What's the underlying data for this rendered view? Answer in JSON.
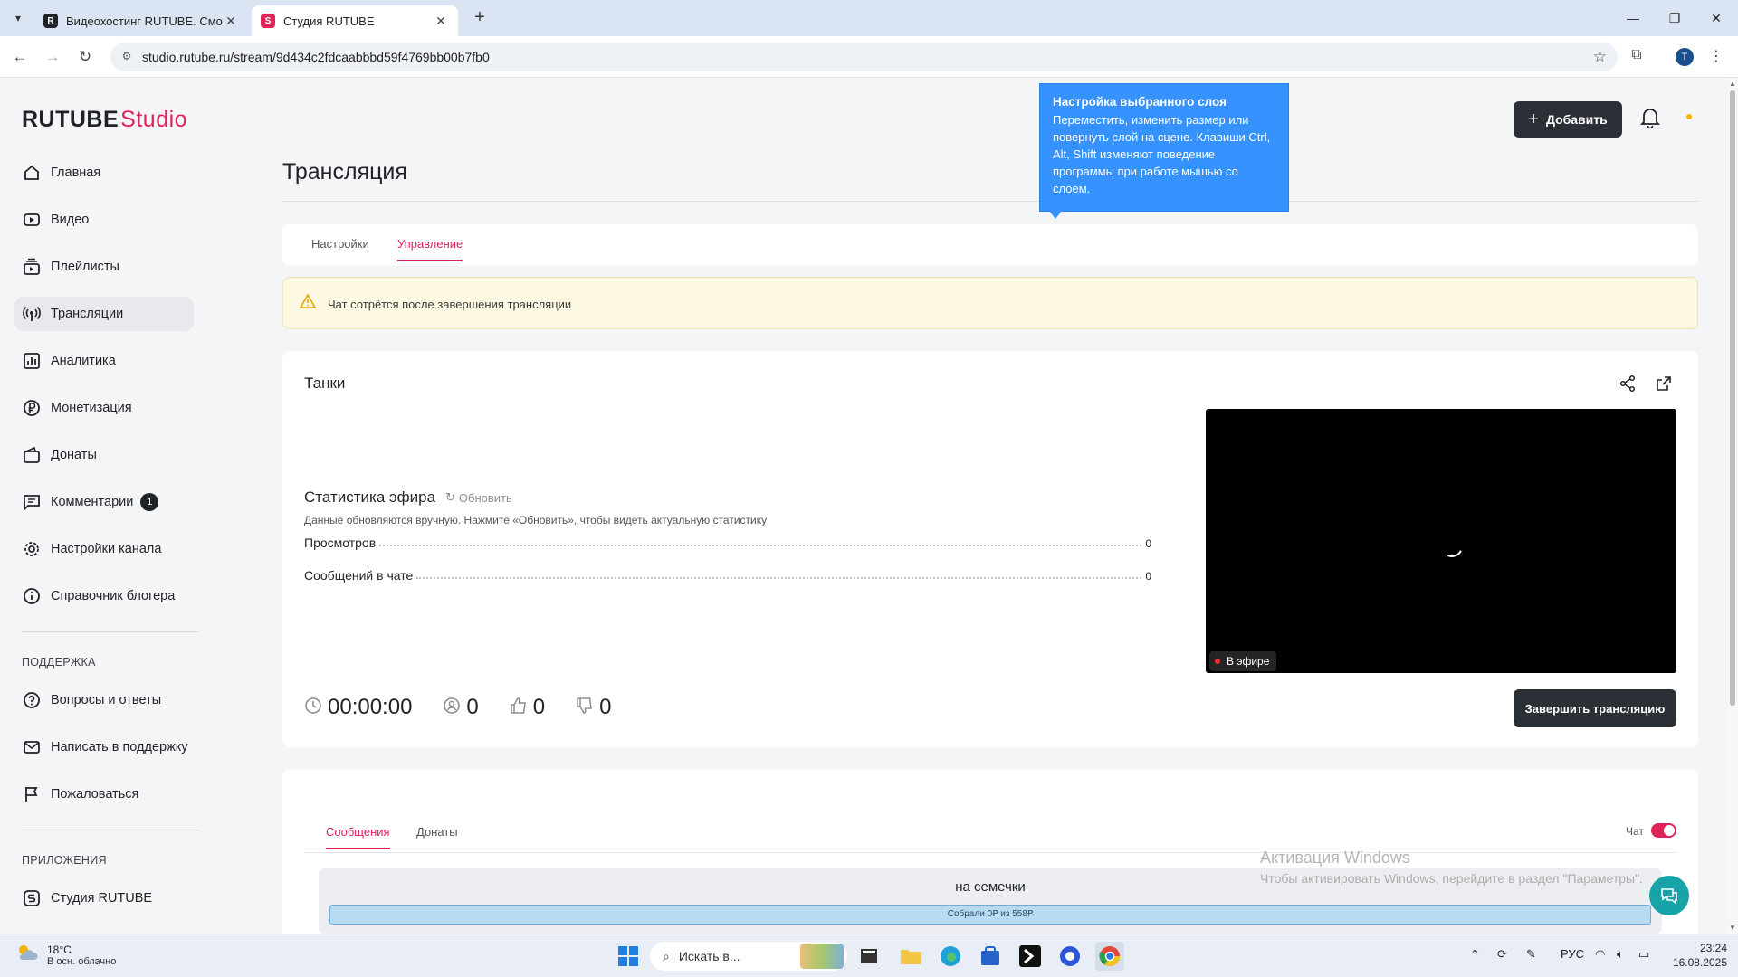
{
  "browser": {
    "tabs": [
      {
        "title": "Видеохостинг RUTUBE. Смотр...",
        "active": false
      },
      {
        "title": "Студия RUTUBE",
        "active": true
      }
    ],
    "url": "studio.rutube.ru/stream/9d434c2fdcaabbbd59f4769bb00b7fb0",
    "profile_initial": "T"
  },
  "header": {
    "logo_main": "RUTUBE",
    "logo_sub": "Studio",
    "add_button": "Добавить"
  },
  "sidebar": {
    "items": [
      {
        "label": "Главная",
        "icon": "home-icon"
      },
      {
        "label": "Видео",
        "icon": "video-icon"
      },
      {
        "label": "Плейлисты",
        "icon": "playlist-icon"
      },
      {
        "label": "Трансляции",
        "icon": "broadcast-icon",
        "active": true
      },
      {
        "label": "Аналитика",
        "icon": "analytics-icon"
      },
      {
        "label": "Монетизация",
        "icon": "ruble-icon"
      },
      {
        "label": "Донаты",
        "icon": "wallet-icon"
      },
      {
        "label": "Комментарии",
        "icon": "comment-icon",
        "badge": "1"
      },
      {
        "label": "Настройки канала",
        "icon": "gear-icon"
      },
      {
        "label": "Справочник блогера",
        "icon": "info-icon"
      }
    ],
    "support_title": "ПОДДЕРЖКА",
    "support_items": [
      {
        "label": "Вопросы и ответы",
        "icon": "question-icon"
      },
      {
        "label": "Написать в поддержку",
        "icon": "mail-icon"
      },
      {
        "label": "Пожаловаться",
        "icon": "flag-icon"
      }
    ],
    "apps_title": "ПРИЛОЖЕНИЯ",
    "apps_items": [
      {
        "label": "Студия RUTUBE",
        "icon": "studio-icon"
      }
    ]
  },
  "main": {
    "title": "Трансляция",
    "tabs": {
      "settings": "Настройки",
      "manage": "Управление"
    },
    "warning": "Чат сотрётся после завершения трансляции",
    "stream": {
      "name": "Танки",
      "stats_title": "Статистика эфира",
      "refresh_label": "Обновить",
      "stats_note": "Данные обновляются вручную. Нажмите «Обновить», чтобы видеть актуальную статистику",
      "views_label": "Просмотров",
      "views_value": "0",
      "messages_label": "Сообщений в чате",
      "messages_value": "0",
      "live_label": "В эфире",
      "timer": "00:00:00",
      "viewers": "0",
      "likes": "0",
      "dislikes": "0",
      "end_button": "Завершить трансляцию"
    },
    "chat": {
      "tab_messages": "Сообщения",
      "tab_donates": "Донаты",
      "chat_toggle_label": "Чат",
      "chat_enabled": true,
      "goal_title": "на семечки",
      "goal_progress": "Собрали 0₽  из 558₽",
      "goal_fraction": 0
    }
  },
  "tooltip": {
    "title": "Настройка выбранного слоя",
    "body": "Переместить, изменить размер или повернуть слой на сцене. Клавиши Ctrl, Alt, Shift изменяют поведение программы при работе мышью со слоем."
  },
  "watermark": {
    "line1": "Активация Windows",
    "line2": "Чтобы активировать Windows, перейдите в раздел \"Параметры\"."
  },
  "taskbar": {
    "temperature": "18°C",
    "weather": "В осн. облачно",
    "search_placeholder": "Искать в...",
    "language": "РУС",
    "time": "23:24",
    "date": "16.08.2025"
  },
  "colors": {
    "accent": "#e0245a",
    "dark_button": "#2b2f36",
    "tooltip_blue": "#3592ff",
    "warning_bg": "#fdf8e1"
  }
}
